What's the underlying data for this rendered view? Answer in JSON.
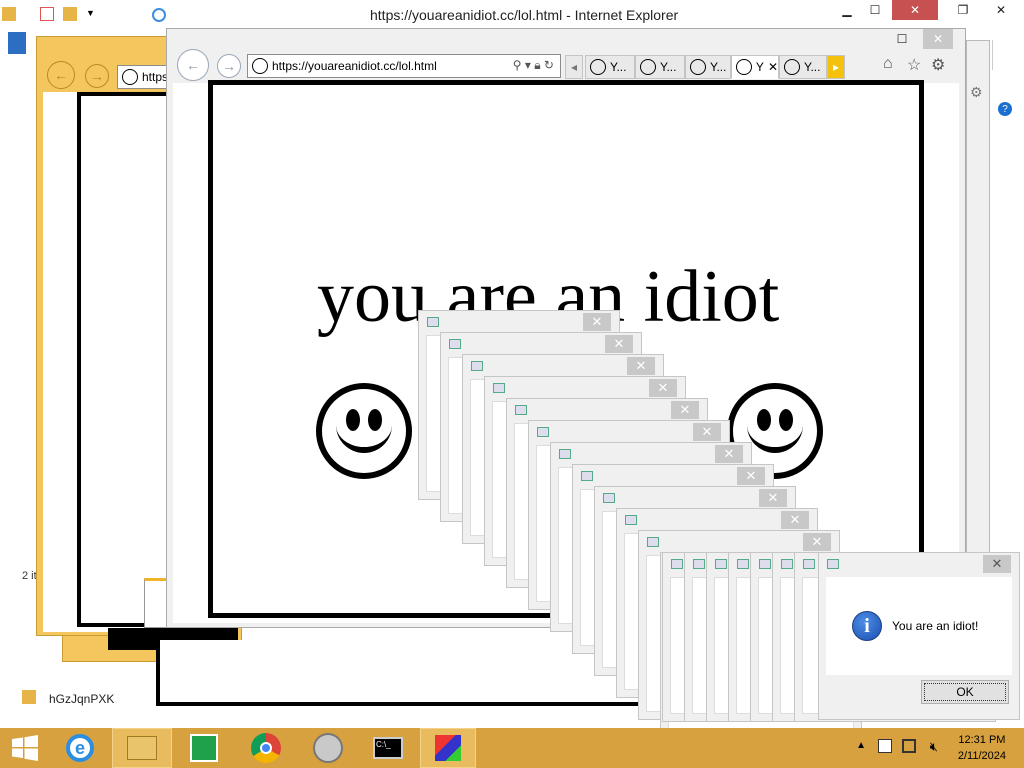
{
  "main_window": {
    "title": "https://youareanidiot.cc/lol.html - Internet Explorer",
    "address": "https://youareanidiot.cc/lol.html",
    "tabs": [
      "Y...",
      "Y...",
      "Y...",
      "Y",
      "Y..."
    ]
  },
  "back_window": {
    "address_partial": "https"
  },
  "page": {
    "headline": "you are an idiot"
  },
  "explorer": {
    "status": "2 it",
    "file_name": "hGzJqnPXK"
  },
  "dialog": {
    "message": "You are an idiot!",
    "ok_label": "OK",
    "close_glyph": "✕"
  },
  "taskbar": {
    "time": "12:31 PM",
    "date": "2/11/2024"
  },
  "colors": {
    "taskbar": "#d7a140",
    "ie_frame": "#f3c75d",
    "close_red": "#c75050"
  }
}
